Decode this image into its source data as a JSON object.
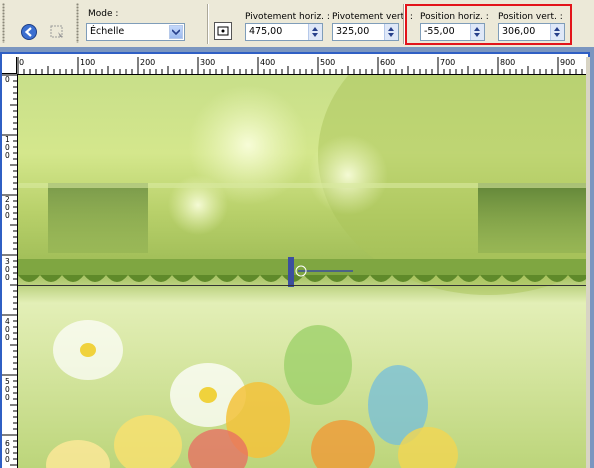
{
  "toolbar": {
    "mode_label": "Mode :",
    "mode_value": "Échelle",
    "pivot_h_label": "Pivotement horiz. :",
    "pivot_h_value": "475,00",
    "pivot_v_label": "Pivotement vert. :",
    "pivot_v_value": "325,00",
    "pos_h_label": "Position horiz. :",
    "pos_h_value": "-55,00",
    "pos_v_label": "Position vert. :",
    "pos_v_value": "306,00"
  },
  "ruler": {
    "h_ticks": [
      "0",
      "100",
      "200",
      "300",
      "400",
      "500",
      "600",
      "700",
      "800",
      "900"
    ],
    "v_ticks": [
      "0",
      "1\n0\n0",
      "2\n0\n0",
      "3\n0\n0",
      "4\n0\n0",
      "5\n0\n0",
      "6\n0\n0"
    ]
  },
  "colors": {
    "highlight": "#e3141a",
    "frame": "#2f5fc4"
  },
  "icons": {
    "apply": "apply-icon",
    "reset": "reset-icon",
    "pivot": "pivot-icon"
  }
}
